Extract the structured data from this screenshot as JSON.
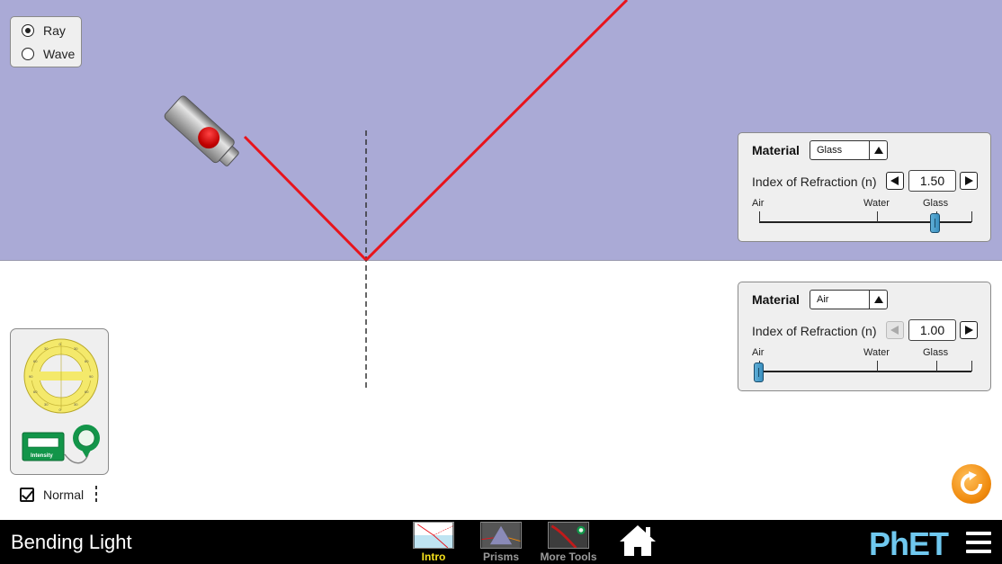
{
  "app": {
    "title": "Bending Light"
  },
  "mode_panel": {
    "options": [
      {
        "label": "Ray",
        "selected": true
      },
      {
        "label": "Wave",
        "selected": false
      }
    ]
  },
  "top_material_panel": {
    "material_label": "Material",
    "material_value": "Glass",
    "ior_label": "Index of Refraction (n)",
    "ior_value": "1.50",
    "ticks": [
      "Air",
      "Water",
      "Glass"
    ],
    "slider_level": 0.83
  },
  "bottom_material_panel": {
    "material_label": "Material",
    "material_value": "Air",
    "ior_label": "Index of Refraction (n)",
    "ior_value": "1.00",
    "ticks": [
      "Air",
      "Water",
      "Glass"
    ],
    "slider_level": 0.0
  },
  "normal_checkbox": {
    "label": "Normal",
    "checked": true
  },
  "navbar": {
    "screens": [
      {
        "label": "Intro",
        "active": true
      },
      {
        "label": "Prisms",
        "active": false
      },
      {
        "label": "More Tools",
        "active": false
      }
    ],
    "logo": "PhET"
  },
  "colors": {
    "top_medium": "#aaaad6",
    "ray": "#e8141c",
    "accent": "#f5e11c"
  },
  "icons": [
    "laser-pointer-icon",
    "protractor-icon",
    "intensity-meter-icon",
    "reset-all-icon",
    "home-icon",
    "menu-icon"
  ]
}
